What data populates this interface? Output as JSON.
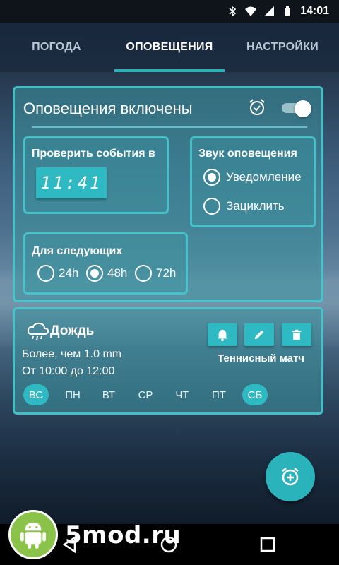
{
  "status_bar": {
    "time": "14:01"
  },
  "tabs": [
    {
      "label": "ПОГОДА",
      "active": false
    },
    {
      "label": "ОПОВЕЩЕНИЯ",
      "active": true
    },
    {
      "label": "НАСТРОЙКИ",
      "active": false
    }
  ],
  "alerts_card": {
    "title": "Оповещения включены",
    "enabled": true,
    "check_label": "Проверить события в",
    "check_time": "11:41",
    "sound_label": "Звук оповещения",
    "sound_options": [
      {
        "label": "Уведомление",
        "selected": true
      },
      {
        "label": "Зациклить",
        "selected": false
      }
    ],
    "next_label": "Для следующих",
    "period_options": [
      {
        "label": "24h",
        "selected": false
      },
      {
        "label": "48h",
        "selected": true
      },
      {
        "label": "72h",
        "selected": false
      }
    ]
  },
  "event_card": {
    "title": "Дождь",
    "condition": "Более, чем 1.0 mm",
    "time_range": "От 10:00 до 12:00",
    "event_name": "Теннисный матч",
    "days": [
      {
        "label": "ВС",
        "selected": true
      },
      {
        "label": "ПН",
        "selected": false
      },
      {
        "label": "ВТ",
        "selected": false
      },
      {
        "label": "СР",
        "selected": false
      },
      {
        "label": "ЧТ",
        "selected": false
      },
      {
        "label": "ПТ",
        "selected": false
      },
      {
        "label": "СБ",
        "selected": true
      }
    ]
  },
  "watermark": {
    "text": "5mod.ru"
  },
  "colors": {
    "accent": "#2fb9c2",
    "border": "#46cdd2",
    "watermark_logo": "#8bc34a"
  }
}
